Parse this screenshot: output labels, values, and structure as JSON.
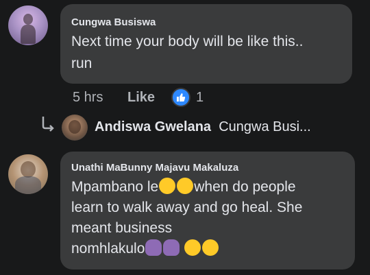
{
  "comments": [
    {
      "author": "Cungwa Busiswa",
      "line1": "Next time your body will be like this..",
      "line2": "run",
      "time": "5 hrs",
      "like_label": "Like",
      "reaction_count": "1"
    },
    {
      "author": "Unathi MaBunny Majavu Makaluza",
      "line1_a": "Mpambano le",
      "line1_b": "when do people",
      "line2": "learn to walk away and go heal. She",
      "line3": "meant business",
      "line4": "nomhlakulo"
    }
  ],
  "reply": {
    "author": "Andiswa Gwelana",
    "preview": "Cungwa Busi..."
  },
  "colors": {
    "background": "#18191a",
    "bubble": "#3a3b3c",
    "like_blue": "#2e89ff"
  },
  "icons": [
    "reply-arrow-icon",
    "thumbs-up-icon"
  ]
}
